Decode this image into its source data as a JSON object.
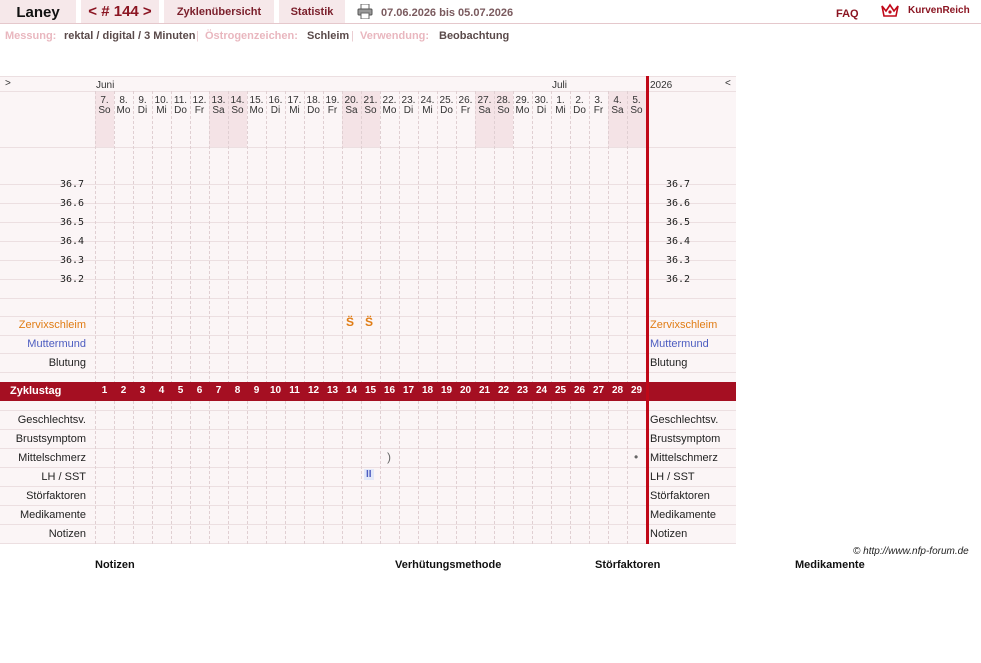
{
  "header": {
    "name": "Laney",
    "cycle_nav": "< # 144 >",
    "tab_overview": "Zyklenübersicht",
    "tab_stats": "Statistik",
    "date_range": "07.06.2026 bis 05.07.2026",
    "faq": "FAQ",
    "brand": "KurvenReich"
  },
  "subheader": {
    "measure_label": "Messung:",
    "measure_value": "rektal / digital / 3 Minuten",
    "estrogen_label": "Östrogenzeichen:",
    "estrogen_value": "Schleim",
    "usage_label": "Verwendung:",
    "usage_value": "Beobachtung"
  },
  "chart": {
    "nav_left": ">",
    "nav_right": "<",
    "month_1": "Juni",
    "month_2": "Juli",
    "year": "2026",
    "days": [
      {
        "d": "7.",
        "w": "So",
        "we": true
      },
      {
        "d": "8.",
        "w": "Mo"
      },
      {
        "d": "9.",
        "w": "Di"
      },
      {
        "d": "10.",
        "w": "Mi"
      },
      {
        "d": "11.",
        "w": "Do"
      },
      {
        "d": "12.",
        "w": "Fr"
      },
      {
        "d": "13.",
        "w": "Sa",
        "we": true
      },
      {
        "d": "14.",
        "w": "So",
        "we": true
      },
      {
        "d": "15.",
        "w": "Mo"
      },
      {
        "d": "16.",
        "w": "Di"
      },
      {
        "d": "17.",
        "w": "Mi"
      },
      {
        "d": "18.",
        "w": "Do"
      },
      {
        "d": "19.",
        "w": "Fr"
      },
      {
        "d": "20.",
        "w": "Sa",
        "we": true
      },
      {
        "d": "21.",
        "w": "So",
        "we": true
      },
      {
        "d": "22.",
        "w": "Mo"
      },
      {
        "d": "23.",
        "w": "Di"
      },
      {
        "d": "24.",
        "w": "Mi"
      },
      {
        "d": "25.",
        "w": "Do"
      },
      {
        "d": "26.",
        "w": "Fr"
      },
      {
        "d": "27.",
        "w": "Sa",
        "we": true
      },
      {
        "d": "28.",
        "w": "So",
        "we": true
      },
      {
        "d": "29.",
        "w": "Mo"
      },
      {
        "d": "30.",
        "w": "Di"
      },
      {
        "d": "1.",
        "w": "Mi"
      },
      {
        "d": "2.",
        "w": "Do"
      },
      {
        "d": "3.",
        "w": "Fr"
      },
      {
        "d": "4.",
        "w": "Sa",
        "we": true
      },
      {
        "d": "5.",
        "w": "So",
        "we": true
      }
    ],
    "temperatures": [
      "36.7",
      "36.6",
      "36.5",
      "36.4",
      "36.3",
      "36.2"
    ],
    "rows_top": [
      "Zervixschleim",
      "Muttermund",
      "Blutung"
    ],
    "zyklustag_label": "Zyklustag",
    "cycle_days": [
      "1",
      "2",
      "3",
      "4",
      "5",
      "6",
      "7",
      "8",
      "9",
      "10",
      "11",
      "12",
      "13",
      "14",
      "15",
      "16",
      "17",
      "18",
      "19",
      "20",
      "21",
      "22",
      "23",
      "24",
      "25",
      "26",
      "27",
      "28",
      "29"
    ],
    "rows_bottom": [
      "Geschlechtsv.",
      "Brustsymptom",
      "Mittelschmerz",
      "LH / SST",
      "Störfaktoren",
      "Medikamente",
      "Notizen"
    ],
    "mucus_marks": [
      {
        "day": 14,
        "symbol": "S̈"
      },
      {
        "day": 15,
        "symbol": "S̈"
      }
    ],
    "mittelschmerz_marks": [
      {
        "day": 16,
        "symbol": ")"
      },
      {
        "day": 29,
        "symbol": "•"
      }
    ],
    "lh_marks": [
      {
        "day": 15,
        "symbol": "II"
      }
    ],
    "colors": {
      "accent": "#a50f22",
      "orange": "#e07c14",
      "blue": "#4c5cc0",
      "weekend": "#f4e3e6"
    }
  },
  "copyright": "© http://www.nfp-forum.de",
  "footer": {
    "notes": "Notizen",
    "method": "Verhütungsmethode",
    "disruptors": "Störfaktoren",
    "meds": "Medikamente"
  }
}
